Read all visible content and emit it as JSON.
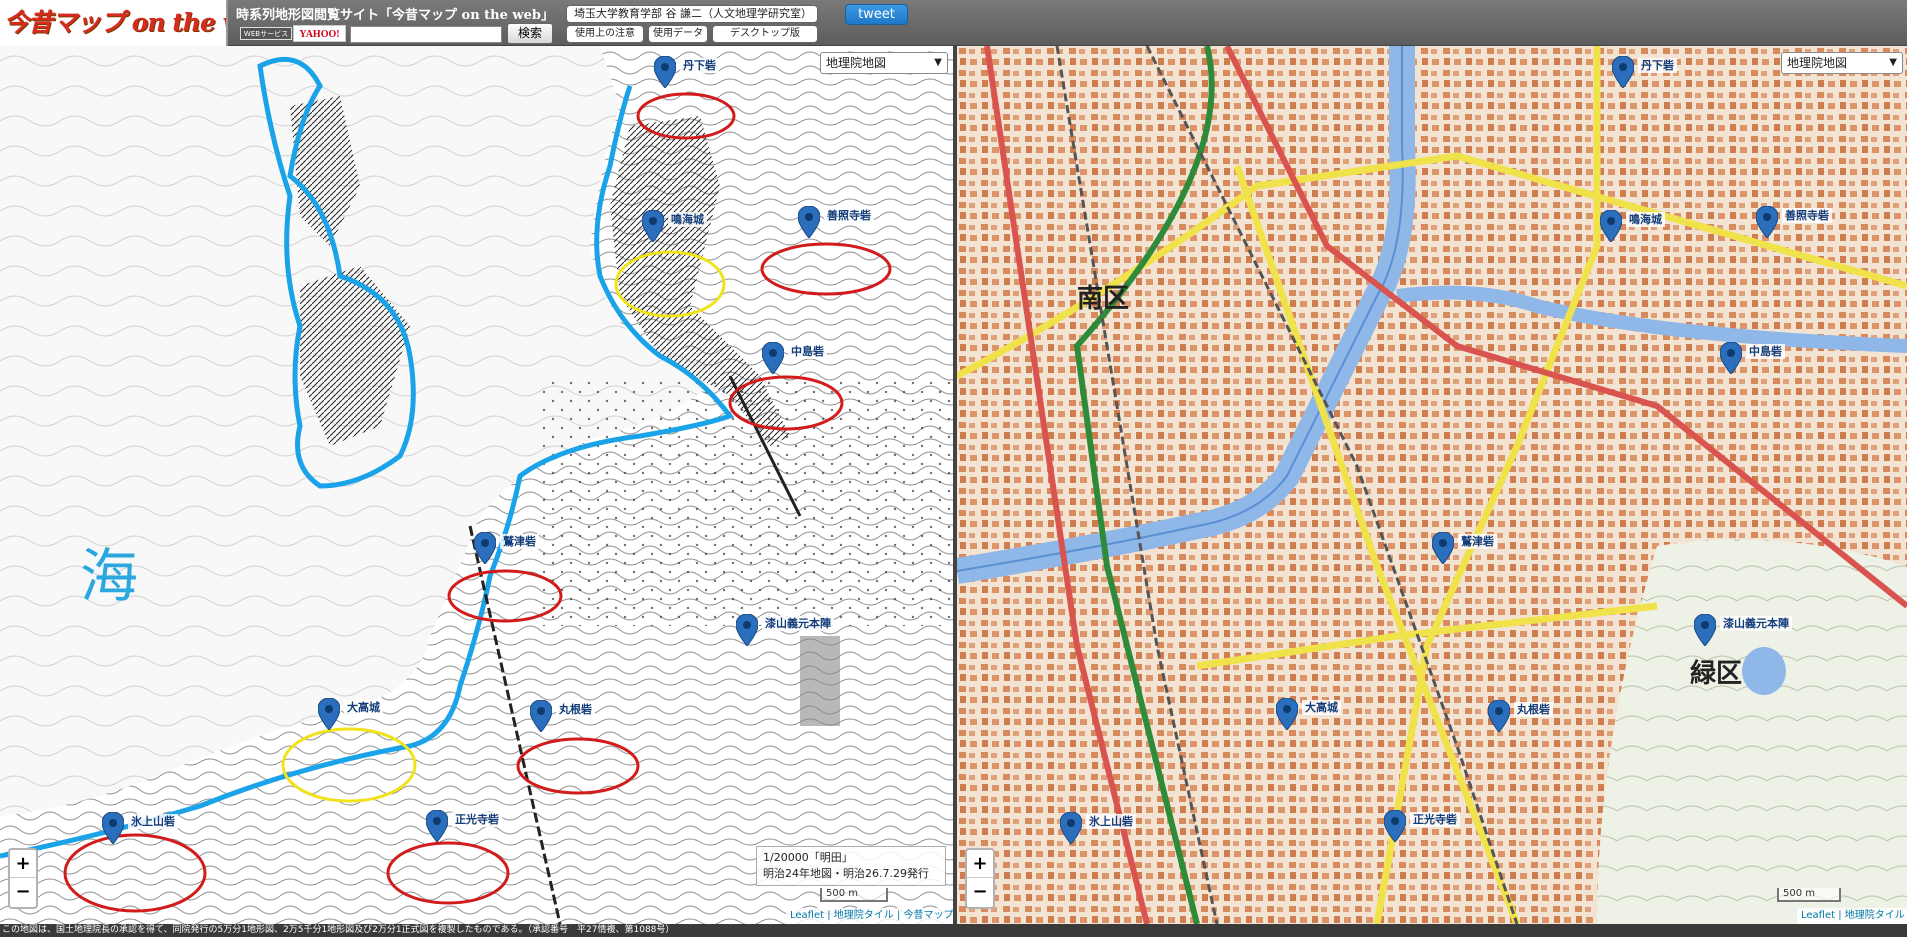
{
  "header": {
    "logo_text": "今昔マップ on the web",
    "site_title": "時系列地形図閲覧サイト「今昔マップ on the web」",
    "web_badge": "WEBサービス",
    "yahoo_badge": "YAHOO!",
    "search_placeholder": "",
    "search_button": "検索",
    "author": "埼玉大学教育学部 谷 謙二（人文地理学研究室）",
    "notice_button": "使用上の注意",
    "data_button": "使用データ",
    "desktop_button": "デスクトップ版",
    "tweet_button": "tweet"
  },
  "left_map": {
    "layer_select": "地理院地図",
    "sea_label": "海",
    "caption_line1": "1/20000「明田」",
    "caption_line2": "明治24年地図・明治26.7.29発行",
    "scale": "500 m",
    "attribution": "Leaflet | 地理院タイル | 今昔マップ",
    "markers": [
      "丹下砦",
      "鳴海城",
      "善照寺砦",
      "中島砦",
      "鷲津砦",
      "漆山義元本陣",
      "大高城",
      "丸根砦",
      "氷上山砦",
      "正光寺砦"
    ],
    "colors": {
      "coast": "#1aa3e8",
      "red_circle": "#d21b1b",
      "yellow_circle": "#f2e21a"
    }
  },
  "right_map": {
    "layer_select": "地理院地図",
    "wards": [
      "南区",
      "緑区"
    ],
    "scale": "500 m",
    "attribution": "Leaflet | 地理院タイル",
    "markers": [
      "丹下砦",
      "鳴海城",
      "善照寺砦",
      "中島砦",
      "鷲津砦",
      "漆山義元本陣",
      "大高城",
      "丸根砦",
      "氷上山砦",
      "正光寺砦"
    ],
    "colors": {
      "river": "#8fb8e8",
      "highway": "#2e8b3a",
      "road_yellow": "#f0e24a",
      "road_red": "#d9534f"
    }
  },
  "footer_text": "この地図は、国土地理院長の承認を得て、同院発行の5万分1地形図、2万5千分1地形図及び2万分1正式図を複製したものである。（承認番号　平27情複、第1088号）"
}
